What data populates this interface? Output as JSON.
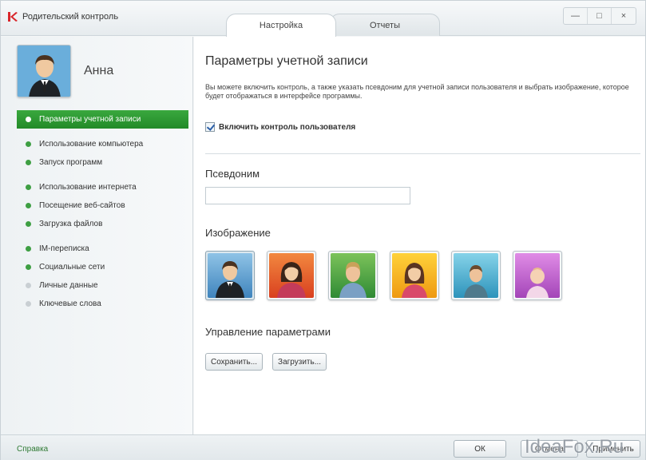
{
  "window": {
    "title": "Родительский контроль",
    "tabs": [
      {
        "label": "Настройка",
        "active": true
      },
      {
        "label": "Отчеты",
        "active": false
      }
    ],
    "controls": {
      "minimize": "—",
      "maximize": "□",
      "close": "×"
    }
  },
  "user": {
    "name": "Анна",
    "avatar_icon": "businessman-avatar-icon"
  },
  "sidebar": {
    "items": [
      {
        "label": "Параметры учетной записи",
        "active": true,
        "enabled": true
      },
      {
        "label": "Использование компьютера",
        "active": false,
        "enabled": true
      },
      {
        "label": "Запуск программ",
        "active": false,
        "enabled": true
      },
      {
        "label": "Использование интернета",
        "active": false,
        "enabled": true
      },
      {
        "label": "Посещение веб-сайтов",
        "active": false,
        "enabled": true
      },
      {
        "label": "Загрузка файлов",
        "active": false,
        "enabled": true
      },
      {
        "label": "IM-переписка",
        "active": false,
        "enabled": true
      },
      {
        "label": "Социальные сети",
        "active": false,
        "enabled": true
      },
      {
        "label": "Личные данные",
        "active": false,
        "enabled": false
      },
      {
        "label": "Ключевые слова",
        "active": false,
        "enabled": false
      }
    ]
  },
  "main": {
    "title": "Параметры учетной записи",
    "description": "Вы можете включить контроль, а также указать псевдоним для учетной записи пользователя и выбрать изображение, которое будет отображаться в интерфейсе программы.",
    "enable_control": {
      "label": "Включить контроль пользователя",
      "checked": true
    },
    "alias": {
      "label": "Псевдоним",
      "value": ""
    },
    "images": {
      "label": "Изображение",
      "items": [
        {
          "icon": "businessman-avatar-icon",
          "selected": true,
          "color": "#4a8fc4"
        },
        {
          "icon": "woman-avatar-icon",
          "selected": false,
          "color": "#e2572a"
        },
        {
          "icon": "boy-avatar-icon",
          "selected": false,
          "color": "#3f9a3c"
        },
        {
          "icon": "girl-avatar-icon",
          "selected": false,
          "color": "#f0a818"
        },
        {
          "icon": "child-avatar-icon",
          "selected": false,
          "color": "#3aa6c9"
        },
        {
          "icon": "baby-avatar-icon",
          "selected": false,
          "color": "#b55bc6"
        }
      ]
    },
    "manage": {
      "label": "Управление параметрами",
      "save_label": "Сохранить...",
      "load_label": "Загрузить..."
    }
  },
  "footer": {
    "help_label": "Справка",
    "ok_label": "ОК",
    "cancel_label": "Отмена",
    "apply_label": "Применить"
  },
  "watermark": "IdeaFox.Ru",
  "colors": {
    "accent_green": "#2e9633",
    "brand_red": "#d9262b"
  }
}
